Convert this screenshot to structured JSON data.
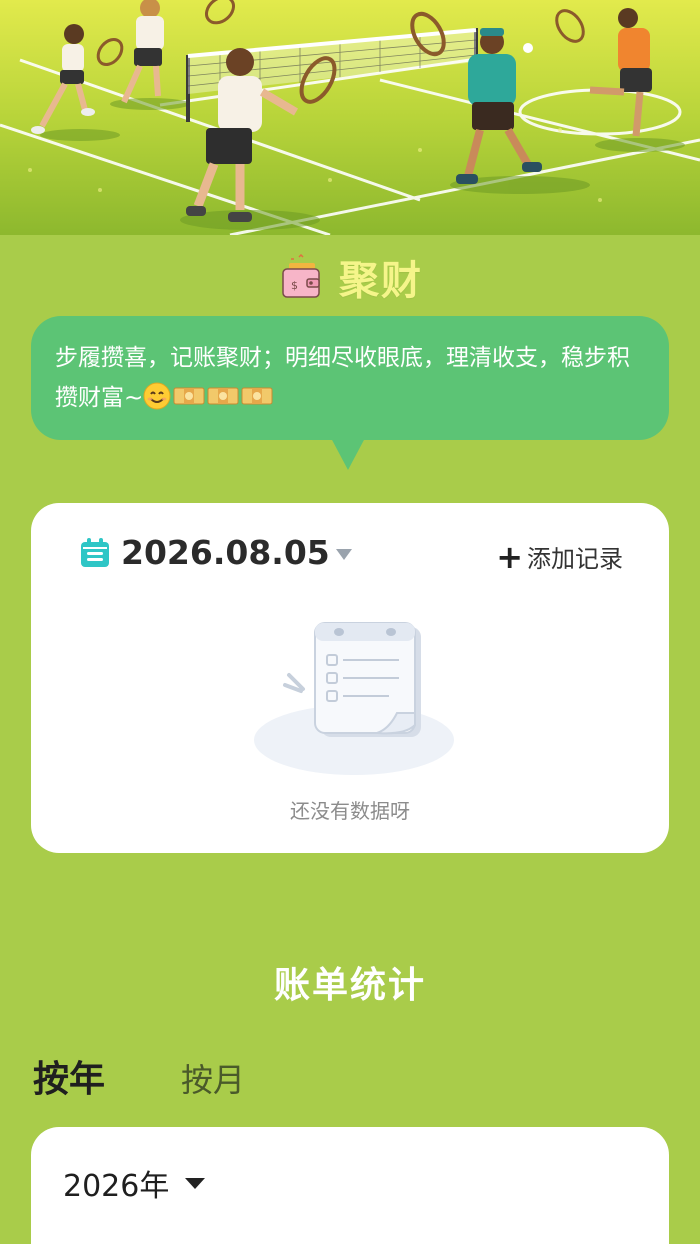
{
  "brand": {
    "title": "聚财"
  },
  "bubble": {
    "text": "步履攒喜，记账聚财；明细尽收眼底，理清收支，稳步积攒财富~"
  },
  "record": {
    "date": "2026.08.05",
    "add_label": "添加记录",
    "empty_text": "还没有数据呀"
  },
  "stats": {
    "title": "账单统计",
    "tabs": [
      {
        "label": "按年",
        "active": true
      },
      {
        "label": "按月",
        "active": false
      }
    ],
    "year_select": "2026年"
  },
  "colors": {
    "page_bg": "#a9cc4a",
    "bubble": "#5cc475",
    "brand_title": "#f5f58a",
    "calendar_icon": "#2fc6c6"
  },
  "icons": [
    "wallet-icon",
    "smile-emoji-icon",
    "money-icon",
    "calendar-icon",
    "caret-down-icon",
    "plus-icon"
  ]
}
